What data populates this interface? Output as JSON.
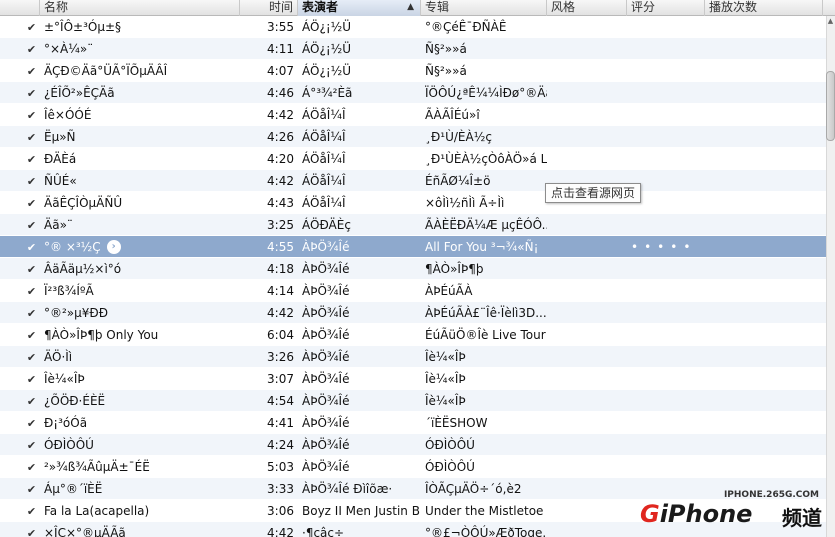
{
  "columns": {
    "name": "名称",
    "time": "时间",
    "artist": "表演者",
    "album": "专辑",
    "genre": "风格",
    "rating": "评分",
    "plays": "播放次数"
  },
  "sort_indicator": "▲",
  "check_mark": "✔",
  "tooltip": "点击查看源网页",
  "watermark": {
    "url": "IPHONE.265G.COM",
    "logo_g": "G",
    "logo_rest": "iPhone",
    "logo_cn": "频道"
  },
  "rows": [
    {
      "name": "±°ÎÔ±³Óµ±§",
      "time": "3:55",
      "artist": "ÁÖ¿¡½Ü",
      "album": "°®ÇéÊ¯ÐÑÀÊ"
    },
    {
      "name": "°×À¼»¨",
      "time": "4:11",
      "artist": "ÁÖ¿¡½Ü",
      "album": "Ñ§²»»á"
    },
    {
      "name": "ÄÇÐ©Äã°ÜÃ°ÏÕµÄÂÎ",
      "time": "4:07",
      "artist": "ÁÖ¿¡½Ü",
      "album": "Ñ§²»»á"
    },
    {
      "name": "¿ÉÎÕ²»ÊÇÄã",
      "time": "4:46",
      "artist": "Á°³¾²Èã",
      "album": "ÏÖÔÚ¿ªÊ¼¼ÌÐø°®Äã(..."
    },
    {
      "name": "Îê×ÓÓÉ",
      "time": "4:42",
      "artist": "ÁÖåÎ¼Î",
      "album": "ÃÀÃÎÉú»î"
    },
    {
      "name": "Ëµ»Ñ",
      "time": "4:26",
      "artist": "ÁÖåÎ¼Î",
      "album": "¸Ð¹Ù/ÈÀ½ç"
    },
    {
      "name": "ÐÄÈá",
      "time": "4:20",
      "artist": "ÁÖåÎ¼Î",
      "album": "¸Ð¹ÙÈÀ½çÒôÀÖ»á L..."
    },
    {
      "name": "ÑÛÉ«",
      "time": "4:42",
      "artist": "ÁÖåÎ¼Î",
      "album": "ÉñÃØ¼Î±ö"
    },
    {
      "name": "ÄãÊÇÎÒµÄÑÛ",
      "time": "4:43",
      "artist": "ÁÖåÎ¼Î",
      "album": "×ôÌì½ñÌì Ã÷Ìì"
    },
    {
      "name": "Äã»¨",
      "time": "3:25",
      "artist": "ÁÖÐÄÈç",
      "album": "ÃÀÈËÐÄ¼Æ µçÊÓÔ..."
    },
    {
      "name": "°® ×³½Ç",
      "time": "4:55",
      "artist": "ÀÞÖ¾Îé",
      "album": "All For You ³¬¾«Ñ¡",
      "selected": true
    },
    {
      "name": "ÂäÃäµ½×ì°ó",
      "time": "4:18",
      "artist": "ÀÞÖ¾Îé",
      "album": "¶ÀÒ»ÎÞ¶þ"
    },
    {
      "name": "Ï²³ß¾ÍºÃ",
      "time": "4:14",
      "artist": "ÀÞÖ¾Îé",
      "album": "ÀÞÉúÃÀ"
    },
    {
      "name": "°®²»µ¥ÐÐ",
      "time": "4:42",
      "artist": "ÀÞÖ¾Îé",
      "album": "ÀÞÉúÃÀ£¨Îê·Ïèlì3D..."
    },
    {
      "name": "¶ÀÒ»ÎÞ¶þ Only You",
      "time": "6:04",
      "artist": "ÀÞÖ¾Îé",
      "album": "ÉúÃüÖ®Îè Live Tour"
    },
    {
      "name": "ÄÖ·Ìì",
      "time": "3:26",
      "artist": "ÀÞÖ¾Îé",
      "album": "Îè¼«ÎÞ"
    },
    {
      "name": "Îè¼«ÎÞ",
      "time": "3:07",
      "artist": "ÀÞÖ¾Îé",
      "album": "Îè¼«ÎÞ"
    },
    {
      "name": "¿ÕÖÐ·ÉÈË",
      "time": "4:54",
      "artist": "ÀÞÖ¾Îé",
      "album": "Îè¼«ÎÞ"
    },
    {
      "name": "Ð¡³óÓã",
      "time": "4:41",
      "artist": "ÀÞÖ¾Îé",
      "album": "´ïÈËSHOW"
    },
    {
      "name": "ÓÐÌÒÔÚ",
      "time": "4:24",
      "artist": "ÀÞÖ¾Îé",
      "album": "ÓÐÌÒÔÚ"
    },
    {
      "name": "²»¾ß¾ÃûµÄ±¯ÉË",
      "time": "5:03",
      "artist": "ÀÞÖ¾Îé",
      "album": "ÓÐÌÒÔÚ"
    },
    {
      "name": "Áµ°®´ïÈË",
      "time": "3:33",
      "artist": "ÀÞÖ¾Îé Ðìîõæ·",
      "album": "ÎÒÃÇµÄÖ÷´ó,è2"
    },
    {
      "name": "Fa la La(acapella)",
      "time": "3:06",
      "artist": "Boyz II Men Justin Bi...",
      "album": "Under the Mistletoe"
    },
    {
      "name": "×ÎÇ×°®µÄÃã",
      "time": "4:42",
      "artist": "·¶çâç÷",
      "album": "°®£¬ÒÔÚ»ÆðToge..."
    }
  ]
}
